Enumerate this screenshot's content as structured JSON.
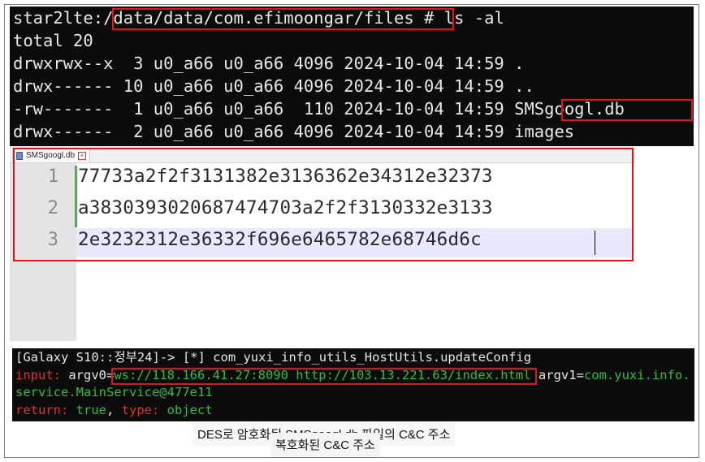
{
  "terminal_top": {
    "line1": {
      "prompt": "star2lte:",
      "path": "/data/data/com.efimoongar/files",
      "command": " # ls -al"
    },
    "line2": "total 20",
    "line3": "drwxrwx--x  3 u0_a66 u0_a66 4096 2024-10-04 14:59 .",
    "line4": "drwx------ 10 u0_a66 u0_a66 4096 2024-10-04 14:59 ..",
    "line5": {
      "prefix": "-rw-------  1 u0_a66 u0_a66  110 2024-10-04 14:59 ",
      "filename": "SMSgoogl.db"
    },
    "line6": "drwx------  2 u0_a66 u0_a66 4096 2024-10-04 14:59 images"
  },
  "editor": {
    "tab_label": "SMSgoogl.db",
    "lines": [
      {
        "num": "1",
        "text": "77733a2f2f3131382e3136362e34312e32373"
      },
      {
        "num": "2",
        "text": "a38303930206874747 03a2f2f3130332e3133"
      },
      {
        "num": "3",
        "text": "2e3232312e36332f696e6465782e68746d6c"
      }
    ],
    "caption": "DES로 암호화된 SMSgoogl.db 파일의 C&C 주소"
  },
  "terminal_bottom": {
    "line1": "[Galaxy S10::정부24]-> [*] com_yuxi_info_utils_HostUtils.updateConfig",
    "line2": {
      "label": "input:",
      "arg0_key": " argv0=",
      "arg0_value": "ws://118.166.41.27:8090 http://103.13.221.63/index.html",
      "arg1_key": " argv1=",
      "arg1_value": "com.yuxi.info."
    },
    "line3": "service.MainService@477e11",
    "line4": {
      "label": "return:",
      "true_value": " true",
      "comma": ",",
      "type_key": " type:",
      "type_value": " object"
    }
  },
  "caption_bottom": "복호화된 C&C 주소",
  "colors": {
    "highlight_box": "#e0141a",
    "terminal_bg": "#0c0c0c",
    "green": "#2fbf3c",
    "red": "#e0332f"
  }
}
